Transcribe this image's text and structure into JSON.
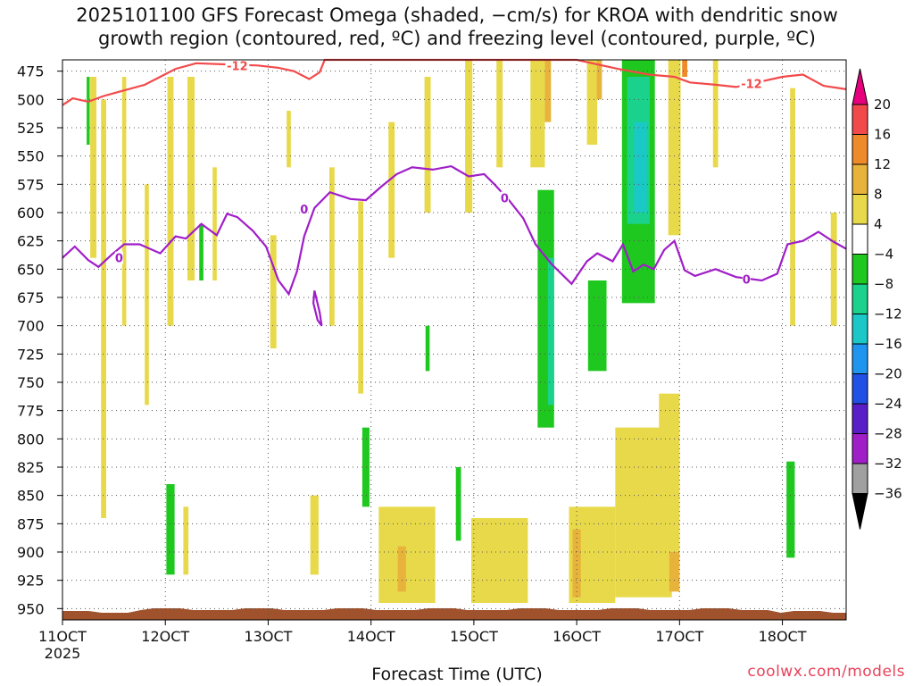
{
  "title": {
    "line1": "2025101100 GFS Forecast Omega (shaded, −cm/s) for KROA with dendritic snow",
    "line2": "growth region (contoured, red, ºC) and freezing level (contoured, purple, ºC)"
  },
  "xlabel": "Forecast Time (UTC)",
  "credit": "coolwx.com/models",
  "chart_data": {
    "type": "heatmap",
    "title": "2025101100 GFS Forecast Omega (shaded, −cm/s) for KROA with dendritic snow growth region (contoured, red, ºC) and freezing level (contoured, purple, ºC)",
    "xlabel": "Forecast Time (UTC)",
    "ylabel": "",
    "y_axis": "pressure (hPa), inverted",
    "ylim": [
      960,
      465
    ],
    "y_ticks": [
      475,
      500,
      525,
      550,
      575,
      600,
      625,
      650,
      675,
      700,
      725,
      750,
      775,
      800,
      825,
      850,
      875,
      900,
      925,
      950
    ],
    "x_ticks": [
      {
        "day": 11,
        "label": "11OCT",
        "sub": "2025"
      },
      {
        "day": 12,
        "label": "12OCT"
      },
      {
        "day": 13,
        "label": "13OCT"
      },
      {
        "day": 14,
        "label": "14OCT"
      },
      {
        "day": 15,
        "label": "15OCT"
      },
      {
        "day": 16,
        "label": "16OCT"
      },
      {
        "day": 17,
        "label": "17OCT"
      },
      {
        "day": 18,
        "label": "18OCT"
      }
    ],
    "xlim": [
      11.0,
      18.62
    ],
    "grid": true,
    "colorbar": {
      "labels": [
        "20",
        "16",
        "12",
        "8",
        "4",
        "−4",
        "−8",
        "−12",
        "−16",
        "−20",
        "−24",
        "−28",
        "−32",
        "−36"
      ],
      "colors": [
        "#e6007e",
        "#f24a4a",
        "#ee8a2a",
        "#e8b33a",
        "#e8d94a",
        "#ffffff",
        "#1ec81e",
        "#1ad28c",
        "#1ac8c8",
        "#1e96f0",
        "#2050e6",
        "#5a1ec8",
        "#a01ec8",
        "#a0a0a0",
        "#000000"
      ]
    },
    "shaded": [
      {
        "x": 11.3,
        "p0": 480,
        "p1": 640,
        "w": 0.06,
        "value": 6
      },
      {
        "x": 11.4,
        "p0": 500,
        "p1": 870,
        "w": 0.05,
        "value": 6
      },
      {
        "x": 11.6,
        "p0": 480,
        "p1": 700,
        "w": 0.04,
        "value": 6
      },
      {
        "x": 11.82,
        "p0": 575,
        "p1": 770,
        "w": 0.04,
        "value": 6
      },
      {
        "x": 12.05,
        "p0": 480,
        "p1": 700,
        "w": 0.06,
        "value": 6
      },
      {
        "x": 12.25,
        "p0": 480,
        "p1": 660,
        "w": 0.07,
        "value": 6
      },
      {
        "x": 12.48,
        "p0": 560,
        "p1": 660,
        "w": 0.04,
        "value": 6
      },
      {
        "x": 13.05,
        "p0": 620,
        "p1": 720,
        "w": 0.06,
        "value": 6
      },
      {
        "x": 13.2,
        "p0": 510,
        "p1": 560,
        "w": 0.04,
        "value": 6
      },
      {
        "x": 13.62,
        "p0": 560,
        "p1": 700,
        "w": 0.05,
        "value": 6
      },
      {
        "x": 13.9,
        "p0": 590,
        "p1": 760,
        "w": 0.05,
        "value": 6
      },
      {
        "x": 14.2,
        "p0": 520,
        "p1": 640,
        "w": 0.06,
        "value": 6
      },
      {
        "x": 14.55,
        "p0": 480,
        "p1": 600,
        "w": 0.06,
        "value": 6
      },
      {
        "x": 14.95,
        "p0": 465,
        "p1": 600,
        "w": 0.07,
        "value": 6
      },
      {
        "x": 15.25,
        "p0": 465,
        "p1": 560,
        "w": 0.06,
        "value": 6
      },
      {
        "x": 15.62,
        "p0": 465,
        "p1": 560,
        "w": 0.14,
        "value": 6
      },
      {
        "x": 15.72,
        "p0": 465,
        "p1": 520,
        "w": 0.06,
        "value": 9
      },
      {
        "x": 16.15,
        "p0": 465,
        "p1": 540,
        "w": 0.1,
        "value": 6
      },
      {
        "x": 16.22,
        "p0": 465,
        "p1": 500,
        "w": 0.05,
        "value": 9
      },
      {
        "x": 16.95,
        "p0": 465,
        "p1": 620,
        "w": 0.12,
        "value": 6
      },
      {
        "x": 17.05,
        "p0": 465,
        "p1": 480,
        "w": 0.05,
        "value": 13
      },
      {
        "x": 17.35,
        "p0": 465,
        "p1": 560,
        "w": 0.05,
        "value": 6
      },
      {
        "x": 18.1,
        "p0": 490,
        "p1": 700,
        "w": 0.05,
        "value": 6
      },
      {
        "x": 18.5,
        "p0": 600,
        "p1": 700,
        "w": 0.06,
        "value": 6
      },
      {
        "x": 16.6,
        "p0": 465,
        "p1": 680,
        "w": 0.32,
        "value": -6
      },
      {
        "x": 16.6,
        "p0": 480,
        "p1": 610,
        "w": 0.22,
        "value": -10
      },
      {
        "x": 16.62,
        "p0": 520,
        "p1": 600,
        "w": 0.12,
        "value": -13
      },
      {
        "x": 15.7,
        "p0": 580,
        "p1": 790,
        "w": 0.16,
        "value": -6
      },
      {
        "x": 15.75,
        "p0": 640,
        "p1": 770,
        "w": 0.06,
        "value": -10
      },
      {
        "x": 16.2,
        "p0": 660,
        "p1": 740,
        "w": 0.18,
        "value": -6
      },
      {
        "x": 12.35,
        "p0": 610,
        "p1": 660,
        "w": 0.04,
        "value": -6
      },
      {
        "x": 11.25,
        "p0": 480,
        "p1": 540,
        "w": 0.03,
        "value": -6
      },
      {
        "x": 12.05,
        "p0": 840,
        "p1": 920,
        "w": 0.08,
        "value": -6
      },
      {
        "x": 13.95,
        "p0": 790,
        "p1": 860,
        "w": 0.07,
        "value": -6
      },
      {
        "x": 14.55,
        "p0": 700,
        "p1": 740,
        "w": 0.04,
        "value": -6
      },
      {
        "x": 14.85,
        "p0": 825,
        "p1": 890,
        "w": 0.05,
        "value": -6
      },
      {
        "x": 18.08,
        "p0": 820,
        "p1": 905,
        "w": 0.08,
        "value": -6
      },
      {
        "x": 14.35,
        "p0": 860,
        "p1": 945,
        "w": 0.55,
        "value": 6
      },
      {
        "x": 14.3,
        "p0": 895,
        "p1": 935,
        "w": 0.08,
        "value": 9
      },
      {
        "x": 15.25,
        "p0": 870,
        "p1": 945,
        "w": 0.55,
        "value": 6
      },
      {
        "x": 16.15,
        "p0": 860,
        "p1": 945,
        "w": 0.45,
        "value": 6
      },
      {
        "x": 16.0,
        "p0": 880,
        "p1": 940,
        "w": 0.08,
        "value": 9
      },
      {
        "x": 16.65,
        "p0": 790,
        "p1": 940,
        "w": 0.55,
        "value": 6
      },
      {
        "x": 16.9,
        "p0": 760,
        "p1": 900,
        "w": 0.2,
        "value": 6
      },
      {
        "x": 16.95,
        "p0": 900,
        "p1": 935,
        "w": 0.1,
        "value": 9
      },
      {
        "x": 13.45,
        "p0": 850,
        "p1": 920,
        "w": 0.08,
        "value": 6
      },
      {
        "x": 12.2,
        "p0": 860,
        "p1": 920,
        "w": 0.05,
        "value": 6
      }
    ],
    "dendritic_minus12_contour": {
      "label": "-12",
      "color": "#f24a4a",
      "points": [
        [
          11.0,
          505
        ],
        [
          11.1,
          499
        ],
        [
          11.25,
          502
        ],
        [
          11.4,
          497
        ],
        [
          11.6,
          492
        ],
        [
          11.8,
          487
        ],
        [
          11.95,
          480
        ],
        [
          12.1,
          473
        ],
        [
          12.3,
          468
        ],
        [
          12.6,
          469
        ],
        [
          12.9,
          470
        ],
        [
          13.1,
          472
        ],
        [
          13.25,
          475
        ],
        [
          13.4,
          482
        ],
        [
          13.5,
          476
        ],
        [
          13.55,
          465
        ],
        [
          16.0,
          465
        ],
        [
          16.2,
          469
        ],
        [
          16.4,
          473
        ],
        [
          16.7,
          478
        ],
        [
          16.95,
          480
        ],
        [
          17.1,
          485
        ],
        [
          17.35,
          487
        ],
        [
          17.55,
          489
        ],
        [
          17.75,
          485
        ],
        [
          18.0,
          480
        ],
        [
          18.2,
          478
        ],
        [
          18.4,
          488
        ],
        [
          18.62,
          491
        ]
      ]
    },
    "freezing_level_0_contour": {
      "label": "0",
      "color": "#a01ec8",
      "points": [
        [
          11.0,
          640
        ],
        [
          11.12,
          630
        ],
        [
          11.25,
          642
        ],
        [
          11.35,
          648
        ],
        [
          11.48,
          637
        ],
        [
          11.6,
          628
        ],
        [
          11.75,
          628
        ],
        [
          11.95,
          636
        ],
        [
          12.1,
          621
        ],
        [
          12.2,
          623
        ],
        [
          12.35,
          610
        ],
        [
          12.5,
          620
        ],
        [
          12.6,
          601
        ],
        [
          12.7,
          604
        ],
        [
          12.85,
          616
        ],
        [
          12.98,
          630
        ],
        [
          13.1,
          660
        ],
        [
          13.2,
          672
        ],
        [
          13.28,
          652
        ],
        [
          13.35,
          621
        ],
        [
          13.45,
          596
        ],
        [
          13.6,
          582
        ],
        [
          13.8,
          588
        ],
        [
          13.95,
          589
        ],
        [
          14.1,
          577
        ],
        [
          14.25,
          566
        ],
        [
          14.4,
          560
        ],
        [
          14.6,
          562
        ],
        [
          14.78,
          559
        ],
        [
          14.95,
          568
        ],
        [
          15.1,
          566
        ],
        [
          15.2,
          575
        ],
        [
          15.35,
          590
        ],
        [
          15.48,
          605
        ],
        [
          15.6,
          628
        ],
        [
          15.75,
          645
        ],
        [
          15.95,
          663
        ],
        [
          16.1,
          643
        ],
        [
          16.2,
          636
        ],
        [
          16.35,
          643
        ],
        [
          16.45,
          628
        ],
        [
          16.55,
          652
        ],
        [
          16.65,
          646
        ],
        [
          16.75,
          650
        ],
        [
          16.85,
          633
        ],
        [
          16.95,
          625
        ],
        [
          17.05,
          651
        ],
        [
          17.15,
          656
        ],
        [
          17.35,
          650
        ],
        [
          17.55,
          657
        ],
        [
          17.8,
          660
        ],
        [
          17.95,
          654
        ],
        [
          18.05,
          628
        ],
        [
          18.2,
          625
        ],
        [
          18.35,
          617
        ],
        [
          18.5,
          626
        ],
        [
          18.62,
          632
        ]
      ]
    },
    "zero_loop": [
      [
        13.45,
        669
      ],
      [
        13.5,
        688
      ],
      [
        13.52,
        700
      ],
      [
        13.48,
        695
      ],
      [
        13.44,
        680
      ],
      [
        13.45,
        669
      ]
    ]
  }
}
